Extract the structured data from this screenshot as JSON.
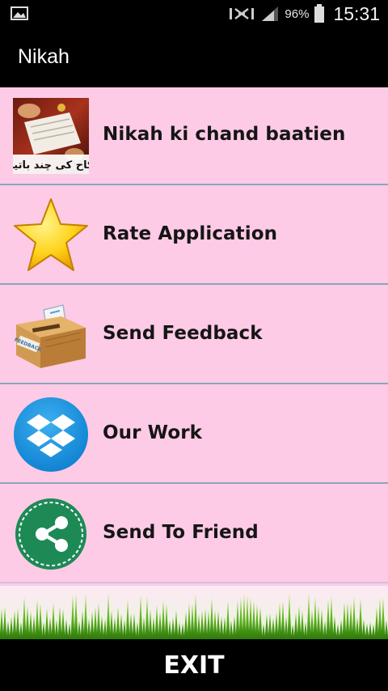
{
  "status_bar": {
    "battery_percent": "96%",
    "time": "15:31",
    "left_icon": "image-icon",
    "right_icons": [
      "mute-icon",
      "signal-icon",
      "battery-icon"
    ]
  },
  "action_bar": {
    "title": "Nikah"
  },
  "menu": {
    "items": [
      {
        "label": "Nikah ki chand baatien",
        "icon": "nikah-thumbnail-icon"
      },
      {
        "label": "Rate Application",
        "icon": "star-icon"
      },
      {
        "label": "Send Feedback",
        "icon": "feedback-box-icon"
      },
      {
        "label": "Our Work",
        "icon": "dropbox-icon"
      },
      {
        "label": "Send To Friend",
        "icon": "share-icon"
      }
    ],
    "thumbnail_caption": "نکاح کی چند باتیں"
  },
  "footer": {
    "exit_label": "EXIT"
  },
  "colors": {
    "list_background": "#fecbe6",
    "divider": "#8aa6bd",
    "bars": "#000000"
  }
}
